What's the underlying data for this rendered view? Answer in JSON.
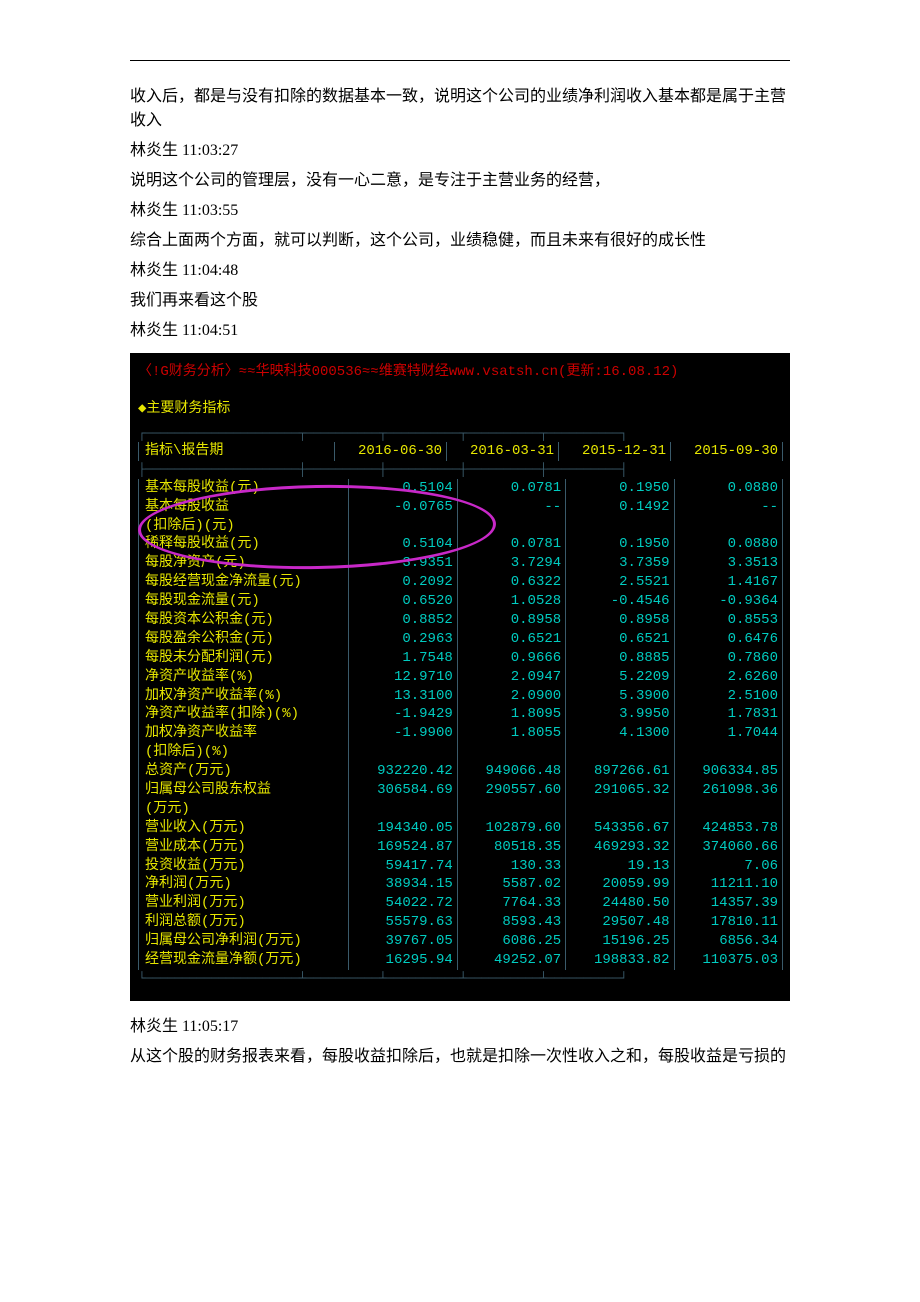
{
  "chat": [
    {
      "text": "收入后，都是与没有扣除的数据基本一致，说明这个公司的业绩净利润收入基本都是属于主营收入"
    },
    {
      "text": "林炎生  11:03:27"
    },
    {
      "text": "说明这个公司的管理层，没有一心二意，是专注于主营业务的经营，"
    },
    {
      "text": "林炎生  11:03:55"
    },
    {
      "text": "综合上面两个方面，就可以判断，这个公司，业绩稳健，而且未来有很好的成长性"
    },
    {
      "text": "林炎生  11:04:48"
    },
    {
      "text": "我们再来看这个股"
    },
    {
      "text": "林炎生  11:04:51"
    }
  ],
  "chat_after": [
    {
      "text": "林炎生  11:05:17"
    },
    {
      "text": "从这个股的财务报表来看，每股收益扣除后，也就是扣除一次性收入之和，每股收益是亏损的"
    }
  ],
  "terminal": {
    "title": "〈!G财务分析〉≈≈华映科技000536≈≈维赛特财经www.vsatsh.cn(更新:16.08.12)",
    "section": "◆主要财务指标",
    "header_label": "指标\\报告期",
    "periods": [
      "2016-06-30",
      "2016-03-31",
      "2015-12-31",
      "2015-09-30"
    ]
  },
  "chart_data": {
    "type": "table",
    "title": "主要财务指标",
    "periods": [
      "2016-06-30",
      "2016-03-31",
      "2015-12-31",
      "2015-09-30"
    ],
    "rows": [
      {
        "label": "基本每股收益(元)",
        "sub": "",
        "v": [
          "0.5104",
          "0.0781",
          "0.1950",
          "0.0880"
        ]
      },
      {
        "label": "基本每股收益",
        "sub": "(扣除后)(元)",
        "v": [
          "-0.0765",
          "--",
          "0.1492",
          "--"
        ]
      },
      {
        "label": "稀释每股收益(元)",
        "sub": "",
        "v": [
          "0.5104",
          "0.0781",
          "0.1950",
          "0.0880"
        ]
      },
      {
        "label": "每股净资产(元)",
        "sub": "",
        "v": [
          "3.9351",
          "3.7294",
          "3.7359",
          "3.3513"
        ]
      },
      {
        "label": "每股经营现金净流量(元)",
        "sub": "",
        "v": [
          "0.2092",
          "0.6322",
          "2.5521",
          "1.4167"
        ]
      },
      {
        "label": "每股现金流量(元)",
        "sub": "",
        "v": [
          "0.6520",
          "1.0528",
          "-0.4546",
          "-0.9364"
        ]
      },
      {
        "label": "每股资本公积金(元)",
        "sub": "",
        "v": [
          "0.8852",
          "0.8958",
          "0.8958",
          "0.8553"
        ]
      },
      {
        "label": "每股盈余公积金(元)",
        "sub": "",
        "v": [
          "0.2963",
          "0.6521",
          "0.6521",
          "0.6476"
        ]
      },
      {
        "label": "每股未分配利润(元)",
        "sub": "",
        "v": [
          "1.7548",
          "0.9666",
          "0.8885",
          "0.7860"
        ]
      },
      {
        "label": "净资产收益率(%)",
        "sub": "",
        "v": [
          "12.9710",
          "2.0947",
          "5.2209",
          "2.6260"
        ]
      },
      {
        "label": "加权净资产收益率(%)",
        "sub": "",
        "v": [
          "13.3100",
          "2.0900",
          "5.3900",
          "2.5100"
        ]
      },
      {
        "label": "净资产收益率(扣除)(%)",
        "sub": "",
        "v": [
          "-1.9429",
          "1.8095",
          "3.9950",
          "1.7831"
        ]
      },
      {
        "label": "加权净资产收益率",
        "sub": "(扣除后)(%)",
        "v": [
          "-1.9900",
          "1.8055",
          "4.1300",
          "1.7044"
        ]
      },
      {
        "label": "总资产(万元)",
        "sub": "",
        "v": [
          "932220.42",
          "949066.48",
          "897266.61",
          "906334.85"
        ]
      },
      {
        "label": "归属母公司股东权益",
        "sub": "(万元)",
        "v": [
          "306584.69",
          "290557.60",
          "291065.32",
          "261098.36"
        ]
      },
      {
        "label": "营业收入(万元)",
        "sub": "",
        "v": [
          "194340.05",
          "102879.60",
          "543356.67",
          "424853.78"
        ]
      },
      {
        "label": "营业成本(万元)",
        "sub": "",
        "v": [
          "169524.87",
          "80518.35",
          "469293.32",
          "374060.66"
        ]
      },
      {
        "label": "投资收益(万元)",
        "sub": "",
        "v": [
          "59417.74",
          "130.33",
          "19.13",
          "7.06"
        ]
      },
      {
        "label": "净利润(万元)",
        "sub": "",
        "v": [
          "38934.15",
          "5587.02",
          "20059.99",
          "11211.10"
        ]
      },
      {
        "label": "营业利润(万元)",
        "sub": "",
        "v": [
          "54022.72",
          "7764.33",
          "24480.50",
          "14357.39"
        ]
      },
      {
        "label": "利润总额(万元)",
        "sub": "",
        "v": [
          "55579.63",
          "8593.43",
          "29507.48",
          "17810.11"
        ]
      },
      {
        "label": "归属母公司净利润(万元)",
        "sub": "",
        "v": [
          "39767.05",
          "6086.25",
          "15196.25",
          "6856.34"
        ]
      },
      {
        "label": "经营现金流量净额(万元)",
        "sub": "",
        "v": [
          "16295.94",
          "49252.07",
          "198833.82",
          "110375.03"
        ]
      }
    ]
  }
}
